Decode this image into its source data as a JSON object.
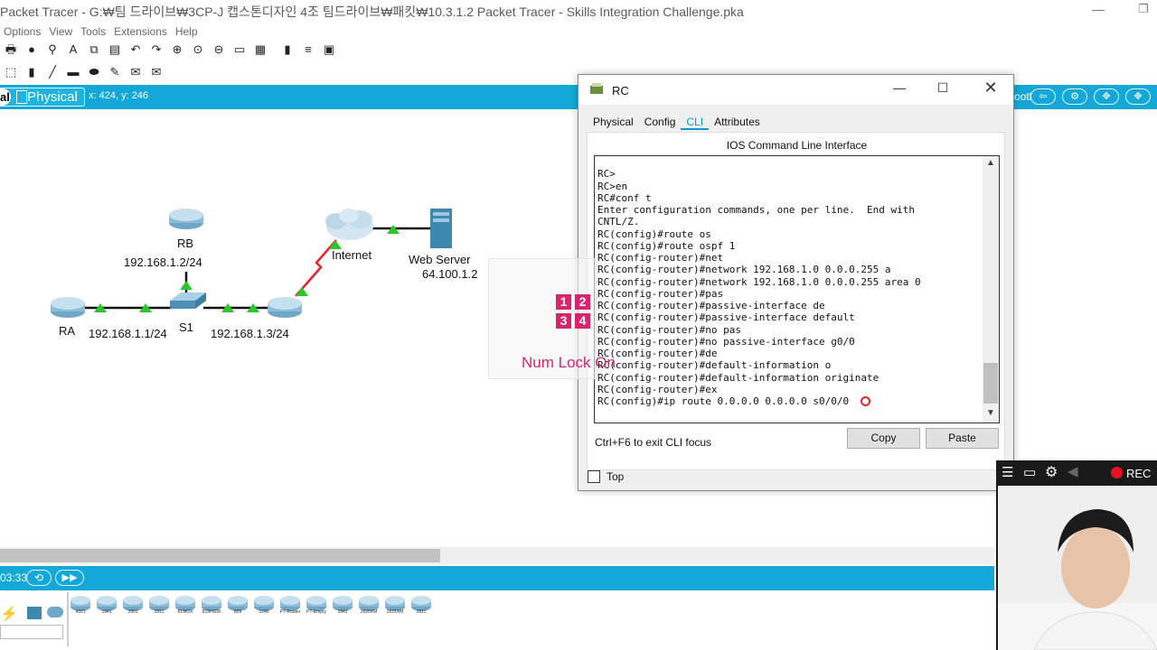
{
  "window": {
    "title": "Packet Tracer - G:₩팀 드라이브₩3CP-J 캡스톤디자인 4조 팀드라이브₩패킷₩10.3.1.2 Packet Tracer - Skills Integration Challenge.pka",
    "minimize": "—",
    "maximize": "❐"
  },
  "menu": [
    "Options",
    "View",
    "Tools",
    "Extensions",
    "Help"
  ],
  "workspace": {
    "mode_prefix": "al",
    "mode": "Physical",
    "coords": "x: 424, y: 246",
    "right_text": "ootl"
  },
  "topology": {
    "devices": {
      "rb": "RB",
      "ra": "RA",
      "s1": "S1",
      "internet": "Internet",
      "web_server": "Web Server"
    },
    "ips": {
      "rb": "192.168.1.2/24",
      "ra": "192.168.1.1/24",
      "rc": "192.168.1.3/24",
      "web": "64.100.1.2"
    }
  },
  "simulation": {
    "time": "03:33"
  },
  "device_models": [
    "4321",
    "1941",
    "2901",
    "2911",
    "819IOX",
    "819HGW",
    "829",
    "1240",
    "PT-Router",
    "PT-Empty",
    "1841",
    "2620XM",
    "2621XM",
    "2811"
  ],
  "rc_dialog": {
    "title": "RC",
    "minimize": "—",
    "maximize": "☐",
    "close": "✕",
    "tabs": [
      "Physical",
      "Config",
      "CLI",
      "Attributes"
    ],
    "active_tab": "CLI",
    "caption": "IOS Command Line Interface",
    "cli_text": "\nRC>\nRC>en\nRC#conf t\nEnter configuration commands, one per line.  End with\nCNTL/Z.\nRC(config)#route os\nRC(config)#route ospf 1\nRC(config-router)#net\nRC(config-router)#network 192.168.1.0 0.0.0.255 a\nRC(config-router)#network 192.168.1.0 0.0.0.255 area 0\nRC(config-router)#pas\nRC(config-router)#passive-interface de\nRC(config-router)#passive-interface default\nRC(config-router)#no pas\nRC(config-router)#no passive-interface g0/0\nRC(config-router)#de\nRC(config-router)#default-information o\nRC(config-router)#default-information originate\nRC(config-router)#ex\nRC(config)#ip route 0.0.0.0 0.0.0.0 s0/0/0",
    "hint": "Ctrl+F6 to exit CLI focus",
    "copy_label": "Copy",
    "paste_label": "Paste",
    "top_label": "Top"
  },
  "numlock": {
    "keys": [
      "1",
      "2",
      "3",
      "4"
    ],
    "label": "Num Lock On"
  },
  "recorder": {
    "label": "REC"
  },
  "colors": {
    "accent": "#13a8d8",
    "numlock": "#d8246b",
    "rec": "#e81123",
    "link_green": "#2cc72c",
    "serial_red": "#e8242a"
  }
}
